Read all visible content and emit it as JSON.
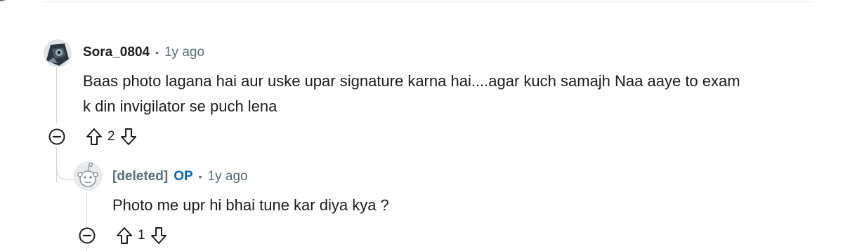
{
  "comments": [
    {
      "username": "Sora_0804",
      "separator": "•",
      "time": "1y ago",
      "body_line1": "Baas photo lagana hai aur uske upar signature karna hai....agar kuch samajh Naa aaye to exam",
      "body_line2": "k din invigilator se puch lena",
      "votes": "2"
    },
    {
      "username": "[deleted]",
      "badge": "OP",
      "separator": "•",
      "time": "1y ago",
      "body": "Photo me upr hi bhai tune kar diya kya ?",
      "votes": "1"
    }
  ],
  "colors": {
    "op_badge": "#0a66c2",
    "meta_text": "#576f76",
    "thread_line": "#d5d5d5"
  },
  "icons": [
    "collapse-icon",
    "upvote-icon",
    "downvote-icon",
    "avatar-robot",
    "avatar-snoo"
  ]
}
